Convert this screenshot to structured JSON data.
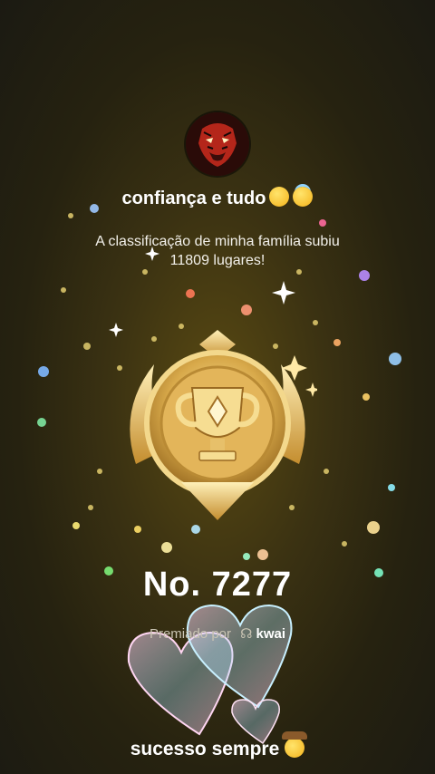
{
  "header": {
    "group_name": "confiança e tudo",
    "group_emojis": [
      "wink-emoji",
      "halo-emoji"
    ]
  },
  "achievement": {
    "line1": "A classificação de minha família subiu",
    "line2": "11809 lugares!"
  },
  "rank": {
    "label": "No. 7277"
  },
  "awarded_by": {
    "prefix": "Premiado por",
    "brand": "kwai"
  },
  "footer": {
    "text": "sucesso sempre",
    "emoji": "cowboy-emoji"
  },
  "colors": {
    "gold": "#e9c46a",
    "background": "#2a2511"
  }
}
